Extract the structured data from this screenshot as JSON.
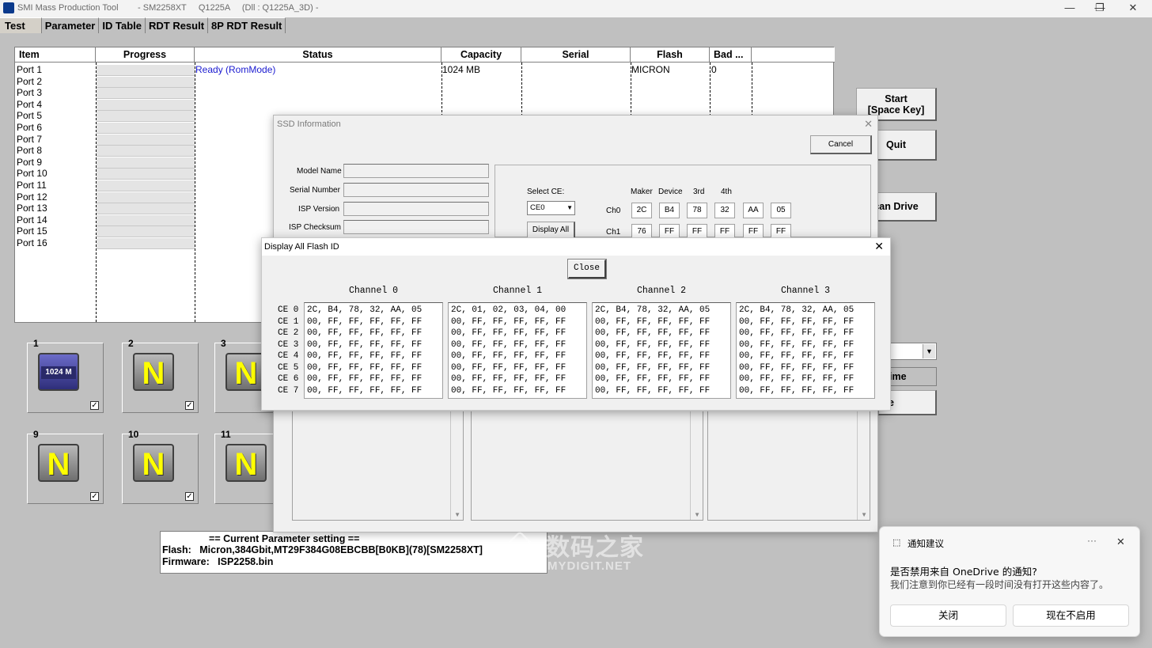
{
  "window": {
    "title": "SMI Mass Production Tool        - SM2258XT     Q1225A     (Dll : Q1225A_3D) -",
    "controls": [
      "—",
      "❐",
      "✕"
    ]
  },
  "tabs": [
    {
      "label": "Test"
    },
    {
      "label": "Parameter"
    },
    {
      "label": "ID Table"
    },
    {
      "label": "RDT Result"
    },
    {
      "label": "8P RDT Result"
    }
  ],
  "table": {
    "headers": [
      "Item",
      "Progress",
      "Status",
      "Capacity",
      "Serial",
      "Flash",
      "Bad ..."
    ],
    "ports": [
      "Port 1",
      "Port 2",
      "Port 3",
      "Port 4",
      "Port 5",
      "Port 6",
      "Port 7",
      "Port 8",
      "Port 9",
      "Port 10",
      "Port 11",
      "Port 12",
      "Port 13",
      "Port 14",
      "Port 15",
      "Port 16"
    ],
    "row1": {
      "status": "Ready (RomMode)",
      "capacity": "1024 MB",
      "serial": "",
      "flash": "MICRON",
      "bad": "0"
    }
  },
  "right_buttons": {
    "start": "Start\n[Space Key]",
    "quit": "Quit",
    "scan": "can Drive",
    "time": "ime",
    "e_btn": "e"
  },
  "drives": [
    {
      "num": "1",
      "label": "1024 M",
      "checked": true
    },
    {
      "num": "2",
      "label": "N",
      "checked": true
    },
    {
      "num": "3",
      "label": "N",
      "checked": false
    },
    {
      "num": "9",
      "label": "N",
      "checked": true
    },
    {
      "num": "10",
      "label": "N",
      "checked": true
    },
    {
      "num": "11",
      "label": "N",
      "checked": false
    }
  ],
  "param": {
    "line1": "                 == Current Parameter setting ==",
    "line2": "Flash:   Micron,384Gbit,MT29F384G08EBCBB[B0KB](78)[SM2258XT]",
    "line3": "Firmware:   ISP2258.bin"
  },
  "ssd_info": {
    "title": "SSD Information",
    "cancel": "Cancel",
    "fields": [
      "Model Name",
      "Serial Number",
      "ISP Version",
      "ISP Checksum"
    ],
    "select_ce_label": "Select CE:",
    "select_ce_value": "CE0",
    "display_all": "Display All",
    "col_heads": [
      "Maker",
      "Device",
      "3rd",
      "4th"
    ],
    "ch0_label": "Ch0",
    "ch1_label": "Ch1",
    "ch0": [
      "2C",
      "B4",
      "78",
      "32",
      "AA",
      "05"
    ],
    "ch1": [
      "76",
      "FF",
      "FF",
      "FF",
      "FF",
      "FF"
    ]
  },
  "flash_dialog": {
    "title": "Display All Flash ID",
    "close": "Close",
    "channels": [
      "Channel 0",
      "Channel 1",
      "Channel 2",
      "Channel 3"
    ],
    "ce_labels": [
      "CE 0",
      "CE 1",
      "CE 2",
      "CE 3",
      "CE 4",
      "CE 5",
      "CE 6",
      "CE 7"
    ],
    "rows": [
      [
        "2C, B4, 78, 32, AA, 05",
        "2C, 01, 02, 03, 04, 00",
        "2C, B4, 78, 32, AA, 05",
        "2C, B4, 78, 32, AA, 05"
      ],
      [
        "00, FF, FF, FF, FF, FF",
        "00, FF, FF, FF, FF, FF",
        "00, FF, FF, FF, FF, FF",
        "00, FF, FF, FF, FF, FF"
      ],
      [
        "00, FF, FF, FF, FF, FF",
        "00, FF, FF, FF, FF, FF",
        "00, FF, FF, FF, FF, FF",
        "00, FF, FF, FF, FF, FF"
      ],
      [
        "00, FF, FF, FF, FF, FF",
        "00, FF, FF, FF, FF, FF",
        "00, FF, FF, FF, FF, FF",
        "00, FF, FF, FF, FF, FF"
      ],
      [
        "00, FF, FF, FF, FF, FF",
        "00, FF, FF, FF, FF, FF",
        "00, FF, FF, FF, FF, FF",
        "00, FF, FF, FF, FF, FF"
      ],
      [
        "00, FF, FF, FF, FF, FF",
        "00, FF, FF, FF, FF, FF",
        "00, FF, FF, FF, FF, FF",
        "00, FF, FF, FF, FF, FF"
      ],
      [
        "00, FF, FF, FF, FF, FF",
        "00, FF, FF, FF, FF, FF",
        "00, FF, FF, FF, FF, FF",
        "00, FF, FF, FF, FF, FF"
      ],
      [
        "00, FF, FF, FF, FF, FF",
        "00, FF, FF, FF, FF, FF",
        "00, FF, FF, FF, FF, FF",
        "00, FF, FF, FF, FF, FF"
      ]
    ]
  },
  "notification": {
    "app": "通知建议",
    "more": "···",
    "close": "✕",
    "title": "是否禁用来自 OneDrive 的通知?",
    "body": "我们注意到你已经有一段时间没有打开这些内容了。",
    "btn_close": "关闭",
    "btn_disable": "现在不启用"
  },
  "watermark": {
    "cn": "数码之家",
    "en": "MYDIGIT.NET"
  },
  "colors": {
    "status_ready": "#1a1ad0",
    "background": "#c0c0c0"
  }
}
